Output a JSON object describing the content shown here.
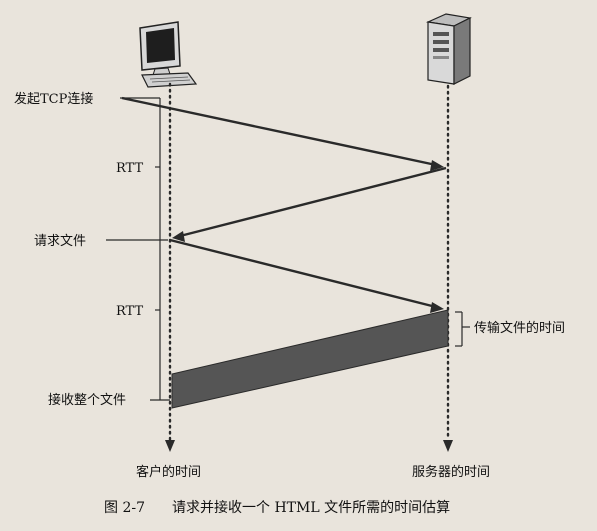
{
  "labels": {
    "initiate_tcp": "发起TCP连接",
    "rtt_top": "RTT",
    "request_file": "请求文件",
    "rtt_bottom": "RTT",
    "transmit_time": "传输文件的时间",
    "receive_file": "接收整个文件",
    "client_time": "客户的时间",
    "server_time": "服务器的时间"
  },
  "caption": {
    "figure_no": "图 2-7",
    "text": "请求并接收一个 HTML 文件所需的时间估算"
  },
  "icons": {
    "client": "desktop-computer-icon",
    "server": "server-tower-icon"
  }
}
